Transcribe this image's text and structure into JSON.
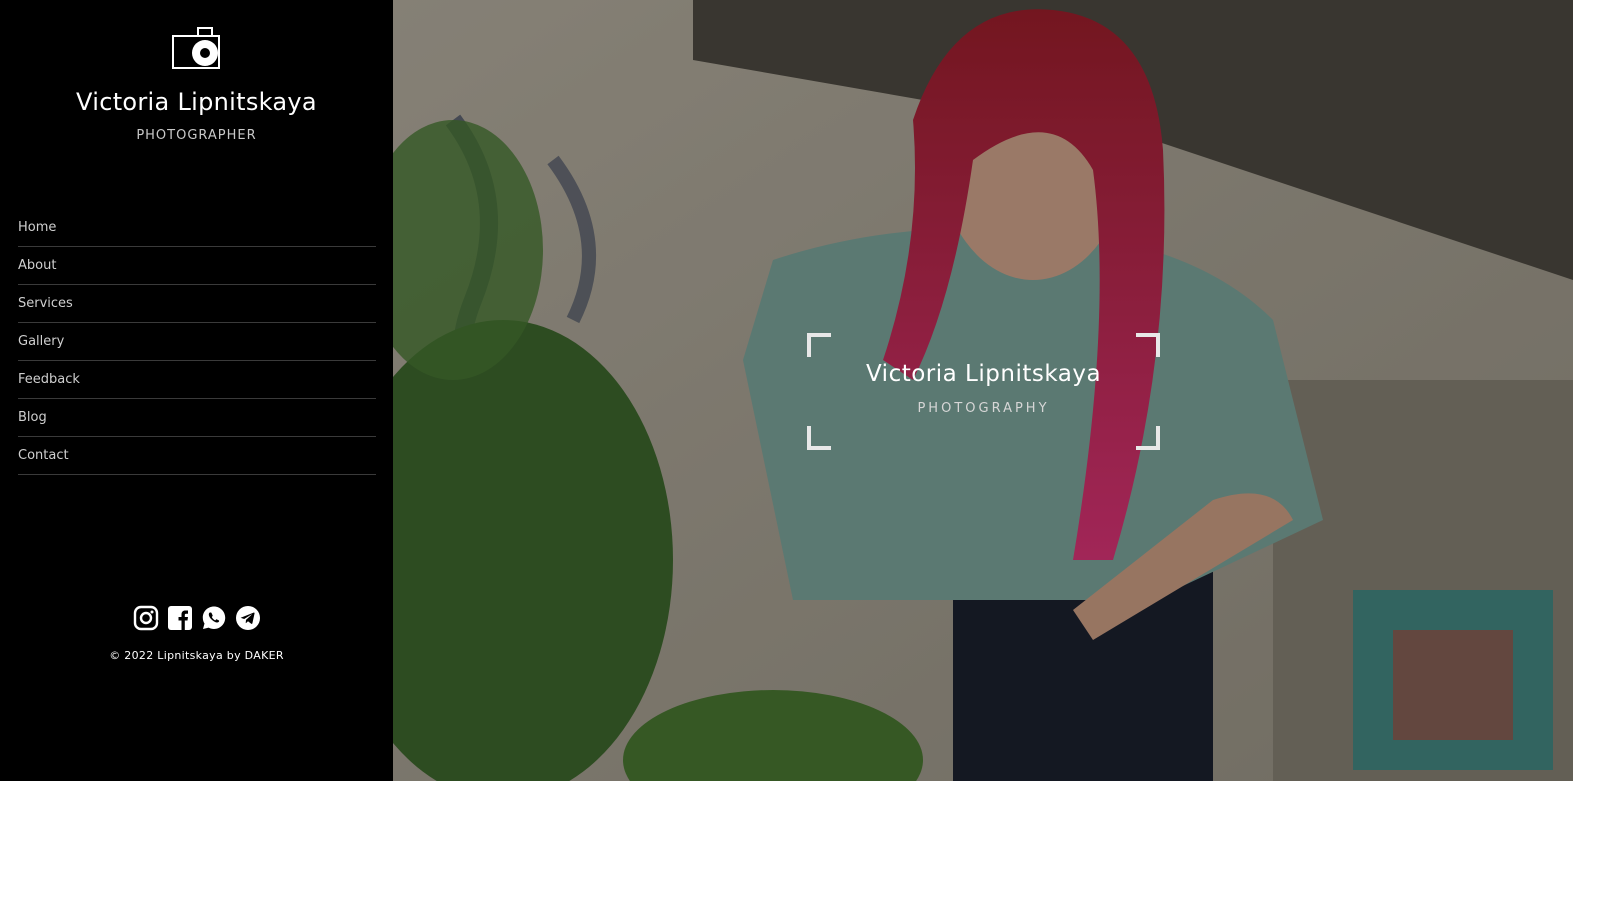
{
  "sidebar": {
    "logo_icon": "camera-icon",
    "name": "Victoria Lipnitskaya",
    "role": "PHOTOGRAPHER",
    "nav": [
      {
        "label": "Home"
      },
      {
        "label": "About"
      },
      {
        "label": "Services"
      },
      {
        "label": "Gallery"
      },
      {
        "label": "Feedback"
      },
      {
        "label": "Blog"
      },
      {
        "label": "Contact"
      }
    ],
    "social": [
      "instagram-icon",
      "facebook-icon",
      "whatsapp-icon",
      "telegram-icon"
    ],
    "copyright": "© 2022 Lipnitskaya by DAKER"
  },
  "hero": {
    "title": "Victoria Lipnitskaya",
    "subtitle": "PHOTOGRAPHY"
  },
  "colors": {
    "sidebar_bg": "#000000",
    "page_bg": "#ffffff",
    "text": "#ffffff"
  }
}
